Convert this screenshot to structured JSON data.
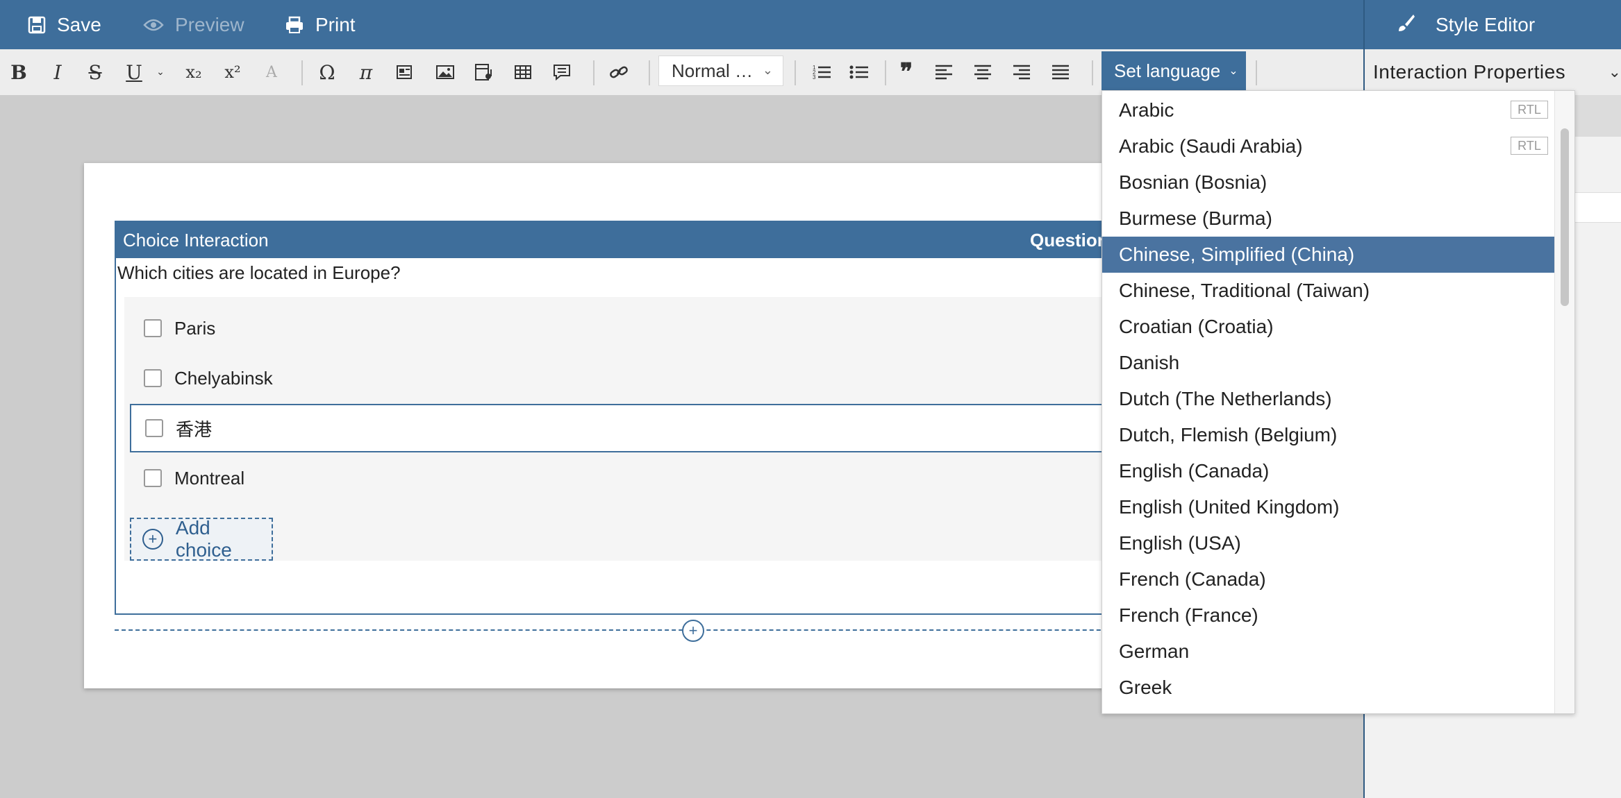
{
  "topbar": {
    "save_label": "Save",
    "preview_label": "Preview",
    "print_label": "Print",
    "style_editor_label": "Style Editor"
  },
  "toolbar": {
    "format_value": "Normal …",
    "set_language_label": "Set language"
  },
  "right_panel": {
    "interaction_properties_label": "Interaction Properties"
  },
  "interaction": {
    "title": "Choice Interaction",
    "header_right": "Question",
    "prompt": "Which cities are located in Europe?",
    "choices": [
      "Paris",
      "Chelyabinsk",
      "香港",
      "Montreal"
    ],
    "add_choice_label": "Add choice"
  },
  "languages": {
    "items": [
      {
        "label": "Arabic",
        "badge": "RTL"
      },
      {
        "label": "Arabic (Saudi Arabia)",
        "badge": "RTL"
      },
      {
        "label": "Bosnian (Bosnia)"
      },
      {
        "label": "Burmese (Burma)"
      },
      {
        "label": "Chinese, Simplified (China)",
        "selected": true
      },
      {
        "label": "Chinese, Traditional (Taiwan)"
      },
      {
        "label": "Croatian (Croatia)"
      },
      {
        "label": "Danish"
      },
      {
        "label": "Dutch (The Netherlands)"
      },
      {
        "label": "Dutch, Flemish (Belgium)"
      },
      {
        "label": "English (Canada)"
      },
      {
        "label": "English (United Kingdom)"
      },
      {
        "label": "English (USA)"
      },
      {
        "label": "French (Canada)"
      },
      {
        "label": "French (France)"
      },
      {
        "label": "German"
      },
      {
        "label": "Greek"
      }
    ]
  },
  "colors": {
    "brand": "#3e6e9b",
    "selected": "#4a73a0"
  }
}
